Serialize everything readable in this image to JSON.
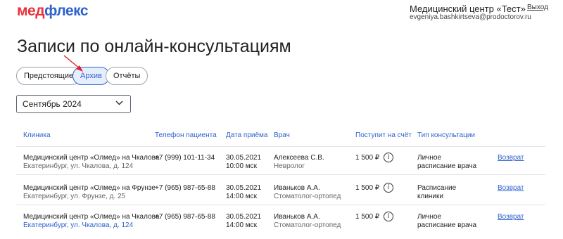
{
  "header": {
    "logo_part1": "мед",
    "logo_part2": "флекс",
    "org_name": "Медицинский центр «Тест»",
    "user_email": "evgeniya.bashkirtseva@prodoctorov.ru",
    "logout_label": "Выход"
  },
  "page": {
    "title": "Записи по онлайн-консультациям"
  },
  "tabs": [
    {
      "label": "Предстоящие",
      "active": false
    },
    {
      "label": "Архив",
      "active": true
    },
    {
      "label": "Отчёты",
      "active": false
    }
  ],
  "month_filter": {
    "value": "Сентябрь 2024",
    "icon": "chevron-down-icon"
  },
  "table": {
    "headers": [
      "Клиника",
      "Телефон пациента",
      "Дата приёма",
      "Врач",
      "Поступит на счёт",
      "Тип консультации"
    ],
    "rows": [
      {
        "clinic": "Медицинский центр «Олмед» на Чкалова",
        "address": "Екатеринбург, ул. Чкалова, д. 124",
        "address_is_link": false,
        "phone": "+7 (999) 101-11-34",
        "date": "30.05.2021",
        "time": "10:00 мск",
        "doctor": "Алексеева С.В.",
        "specialty": "Невролог",
        "amount": "1 500 ₽",
        "type_line1": "Личное",
        "type_line2": "расписание врача",
        "action": "Возврат"
      },
      {
        "clinic": "Медицинский центр «Олмед» на Фрунзе",
        "address": "Екатеринбург, ул. Фрунзе, д. 25",
        "address_is_link": false,
        "phone": "+7 (965) 987-65-88",
        "date": "30.05.2021",
        "time": "14:00 мск",
        "doctor": "Иваньков А.А.",
        "specialty": "Стоматолог-ортопед",
        "amount": "1 500 ₽",
        "type_line1": "Расписание",
        "type_line2": "клиники",
        "action": "Возврат"
      },
      {
        "clinic": "Медицинский центр «Олмед» на Чкалова",
        "address": "Екатеринбург, ул. Чкалова, д. 124",
        "address_is_link": true,
        "phone": "+7 (965) 987-65-88",
        "date": "30.05.2021",
        "time": "14:00 мск",
        "doctor": "Иваньков А.А.",
        "specialty": "Стоматолог-ортопед",
        "amount": "1 500 ₽",
        "type_line1": "Личное",
        "type_line2": "расписание врача",
        "action": "Возврат"
      }
    ]
  },
  "colors": {
    "logo_red": "#e8323c",
    "accent_blue": "#2f62cf",
    "annotation_arrow": "#e0202a"
  }
}
